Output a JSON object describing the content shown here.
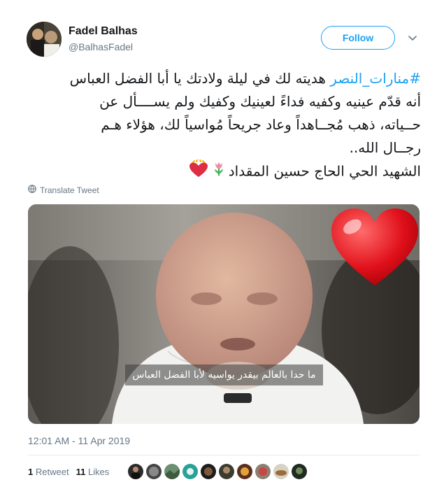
{
  "user": {
    "name": "Fadel Balhas",
    "handle": "@BalhasFadel",
    "follow_label": "Follow"
  },
  "tweet": {
    "hashtag": "#منارات_النصر",
    "line1_rest": " هديته لك في ليلة ولادتك يا أبا الفضل العباس",
    "line2": "أنه قدّم عينيه وكفيه فداءً لعينيك وكفيك ولم يســــأل عن",
    "line3": "حــياته، ذهب مُجــاهداً وعاد جريحاً مُواسياً لك، هؤلاء هـم",
    "line4": "رجــال الله..",
    "line5": "الشهيد الحي الحاج حسين المقداد"
  },
  "translate_label": "Translate Tweet",
  "media": {
    "subtitle": "ما حدا بالعالم بيقدر يواسيه لأبا الفضل العباس"
  },
  "timestamp": "12:01 AM - 11 Apr 2019",
  "stats": {
    "retweets_count": "1",
    "retweets_label": "Retweet",
    "likes_count": "11",
    "likes_label": "Likes"
  },
  "icons": {
    "menu": "chevron-down-icon",
    "translate": "globe-icon",
    "emoji1": "tulip-emoji-icon",
    "emoji2": "heart-with-halo-emoji-icon",
    "overlay": "red-heart-icon"
  },
  "colors": {
    "accent": "#1da1f2",
    "secondary_text": "#657786",
    "text": "#14171a",
    "divider": "#e6ecf0"
  },
  "likers_count_shown": 10
}
